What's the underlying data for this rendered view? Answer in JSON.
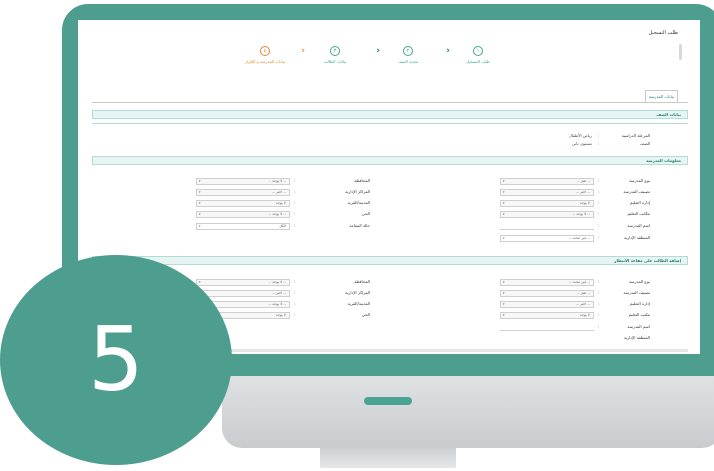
{
  "page_title": "طلب التسجيل",
  "steps": [
    {
      "num": "١",
      "label": "طلب التسجيل",
      "active": false
    },
    {
      "num": "٢",
      "label": "تحديد الصف",
      "active": false
    },
    {
      "num": "٣",
      "label": "بيانات الطالب",
      "active": false
    },
    {
      "num": "٤",
      "label": "بيانات المدرسة و الإقرار",
      "active": true
    }
  ],
  "tab_label": "بيانات المدرسة",
  "section_class": "بيانات الصف",
  "class_fields": [
    {
      "label": "المرحلة الدراسية",
      "value": "رياض الأطفال"
    },
    {
      "label": "الصف",
      "value": "مستوى ثاني"
    }
  ],
  "section_school_info": "معلومات المدرسة",
  "school_right": [
    {
      "label": "نوع المدرسة",
      "value": "-- تعم --"
    },
    {
      "label": "تصنيف المدرسة",
      "value": "-- اختر --"
    },
    {
      "label": "إدارة التعليم",
      "value": "لا يوجد"
    },
    {
      "label": "مكاتب التعليم",
      "value": "-- لا يوجد --"
    },
    {
      "label": "اسم المدرسة",
      "value": ""
    },
    {
      "label": "المنطقة الإدارية",
      "value": "-- غير محدد --"
    }
  ],
  "school_left": [
    {
      "label": "المحافظة",
      "value": "-- لا يوجد --"
    },
    {
      "label": "المراكز الإدارية",
      "value": "-- اختر --"
    },
    {
      "label": "المدينة/القرية",
      "value": "لا يوجد"
    },
    {
      "label": "الحي",
      "value": "-- لا يوجد --"
    },
    {
      "label": "حالة المقاعد",
      "value": "الكل"
    }
  ],
  "section_waiting": "إضافة الطالب على مقاعد الانتظار",
  "wait_right": [
    {
      "label": "نوع المدرسة",
      "value": "-- غير محدد --"
    },
    {
      "label": "تصنيف المدرسة",
      "value": "-- تعم --"
    },
    {
      "label": "إدارة التعليم",
      "value": "-- اختر --"
    },
    {
      "label": "مكتب التعليم",
      "value": "لا يوجد"
    },
    {
      "label": "اسم المدرسة",
      "value": ""
    },
    {
      "label": "المنطقة الإدارية",
      "value": ""
    }
  ],
  "wait_left": [
    {
      "label": "المحافظة",
      "value": "-- لا يوجد --"
    },
    {
      "label": "المراكز الإدارية",
      "value": "-- اختر --"
    },
    {
      "label": "المدينة/القرية",
      "value": "-- لا يوجد --"
    },
    {
      "label": "الحي",
      "value": "لا يوجد"
    }
  ],
  "badge_number": "5",
  "colors": {
    "teal": "#4e9e8f",
    "accent_green": "#3daa8e",
    "active_orange": "#e3892e"
  }
}
